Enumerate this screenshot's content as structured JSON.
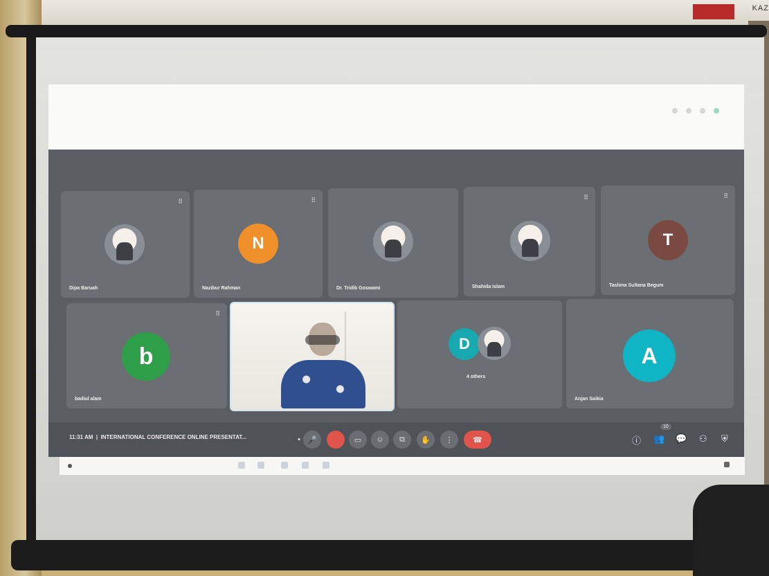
{
  "banner": {
    "text": "KAZ"
  },
  "meeting": {
    "time": "11:31 AM",
    "title": "INTERNATIONAL CONFERENCE ONLINE PRESENTAT...",
    "participant_count": "10",
    "row1": [
      {
        "name": "Dipa Baruah",
        "avatar_type": "photo",
        "initial": ""
      },
      {
        "name": "Nazibur Rahman",
        "avatar_type": "initial",
        "initial": "N",
        "color": "#f0902a"
      },
      {
        "name": "Dr. Tridib Goswami",
        "avatar_type": "photo",
        "initial": ""
      },
      {
        "name": "Shahida Islam",
        "avatar_type": "photo",
        "initial": ""
      },
      {
        "name": "Taslima Sultana Begum",
        "avatar_type": "initial",
        "initial": "T",
        "color": "#7a4a42"
      }
    ],
    "row2": [
      {
        "name": "badiul alam",
        "avatar_type": "initial",
        "initial": "b",
        "color": "#2e9e48"
      },
      {
        "name": "",
        "avatar_type": "video"
      },
      {
        "name": "4 others",
        "avatar_type": "group",
        "initial": "D",
        "color": "#18a9b0"
      },
      {
        "name": "Anjan Saikia",
        "avatar_type": "initial",
        "initial": "A",
        "color": "#0fb5c5"
      }
    ]
  },
  "controls": {
    "icons": [
      "more-icon",
      "mic-icon",
      "camera-icon",
      "captions-icon",
      "emoji-icon",
      "present-icon",
      "raise-hand-icon",
      "more-options-icon",
      "end-call-icon"
    ],
    "glyphs": [
      "•",
      "🎤",
      "▭",
      "☺",
      "⧉",
      "✋",
      "⋮",
      "☎"
    ],
    "right_icons": [
      "info-icon",
      "people-icon",
      "chat-icon",
      "activities-icon",
      "shield-icon"
    ],
    "right_glyphs": [
      "ⓘ",
      "👥",
      "💬",
      "⚇",
      "⛨"
    ]
  }
}
